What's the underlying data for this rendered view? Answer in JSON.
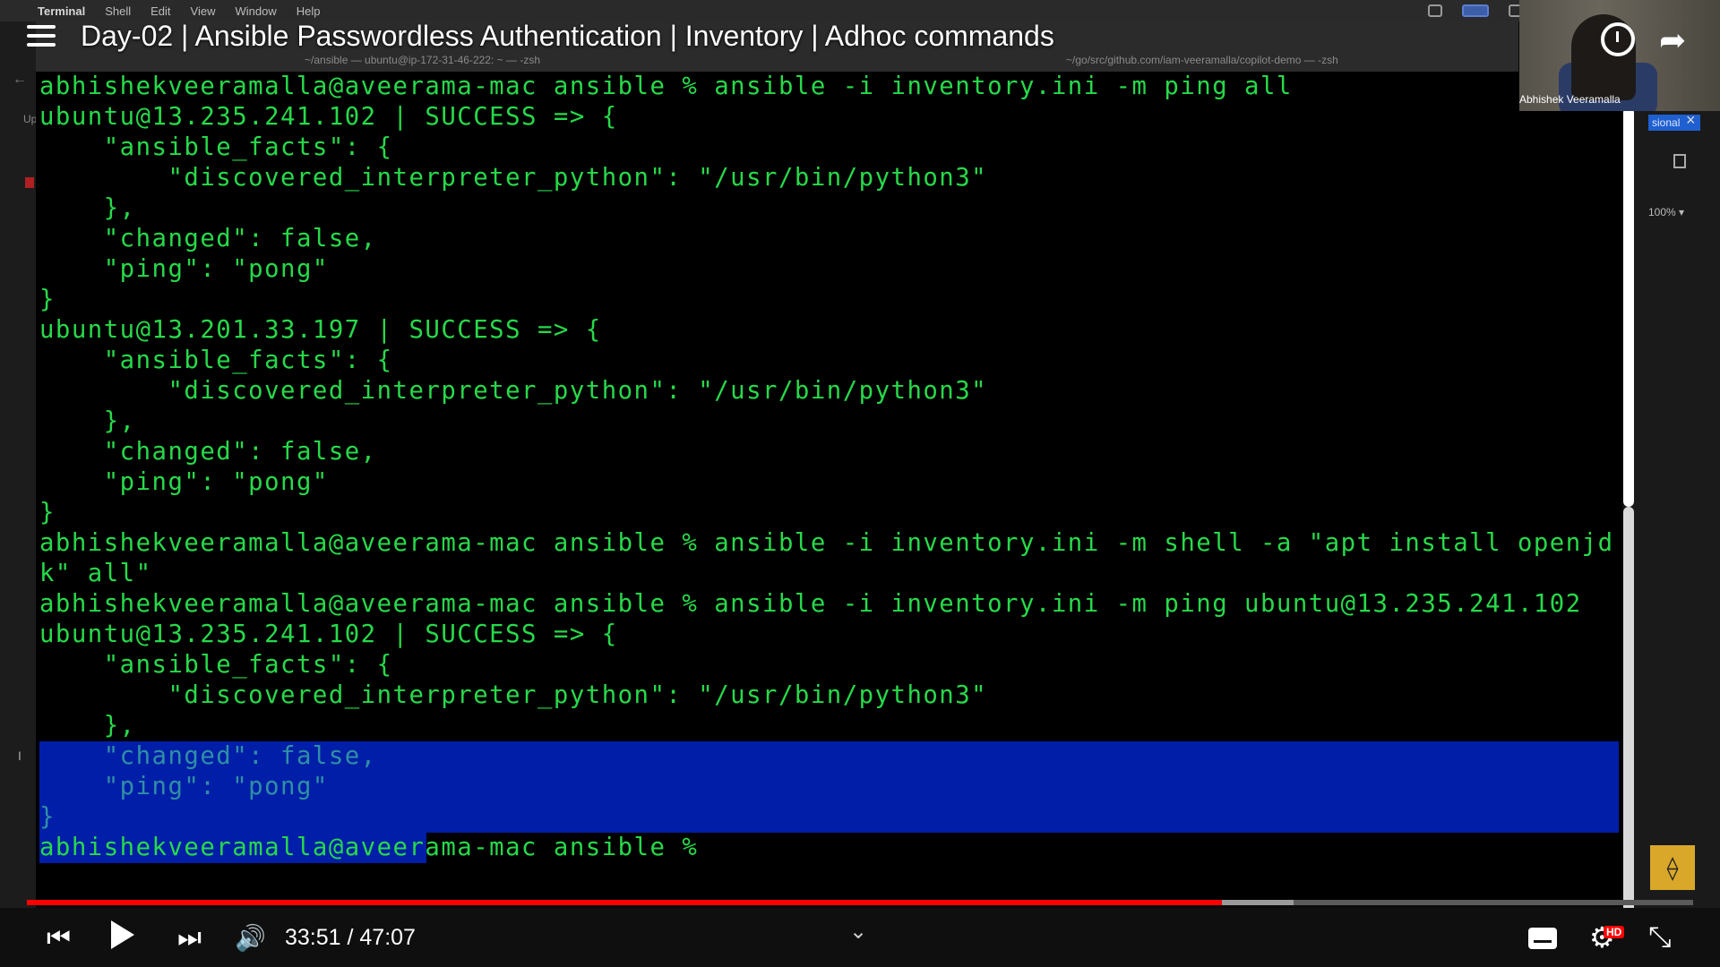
{
  "menubar": {
    "apple": "",
    "app": "Terminal",
    "items": [
      "Shell",
      "Edit",
      "View",
      "Window",
      "Help"
    ]
  },
  "tabs": {
    "tab1": "~/ansible — ubuntu@ip-172-31-46-222: ~ — -zsh",
    "tab2": "~/go/src/github.com/iam-veeramalla/copilot-demo — -zsh"
  },
  "video": {
    "title": "Day-02 | Ansible Passwordless Authentication | Inventory | Adhoc commands",
    "presenter": "Abhishek Veeramalla",
    "time": "33:51 / 47:07",
    "played_fraction": 0.717,
    "buffered_fraction": 0.76,
    "hd_badge": "HD"
  },
  "side": {
    "label": "sional",
    "close": "×",
    "zoom": "100% ▾",
    "left_label": "Up"
  },
  "terminal": {
    "lines": [
      "abhishekveeramalla@aveerama-mac ansible % ansible -i inventory.ini -m ping all",
      "ubuntu@13.235.241.102 | SUCCESS => {",
      "    \"ansible_facts\": {",
      "        \"discovered_interpreter_python\": \"/usr/bin/python3\"",
      "    },",
      "    \"changed\": false,",
      "    \"ping\": \"pong\"",
      "}",
      "ubuntu@13.201.33.197 | SUCCESS => {",
      "    \"ansible_facts\": {",
      "        \"discovered_interpreter_python\": \"/usr/bin/python3\"",
      "    },",
      "    \"changed\": false,",
      "    \"ping\": \"pong\"",
      "}",
      "abhishekveeramalla@aveerama-mac ansible % ansible -i inventory.ini -m shell -a \"apt install openjd",
      "k\" all\"",
      "abhishekveeramalla@aveerama-mac ansible % ansible -i inventory.ini -m ping ubuntu@13.235.241.102",
      "ubuntu@13.235.241.102 | SUCCESS => {",
      "    \"ansible_facts\": {",
      "        \"discovered_interpreter_python\": \"/usr/bin/python3\"",
      "    },",
      "    \"changed\": false,",
      "    \"ping\": \"pong\"",
      "}",
      "abhishekveeramalla@aveerama-mac ansible %"
    ]
  }
}
